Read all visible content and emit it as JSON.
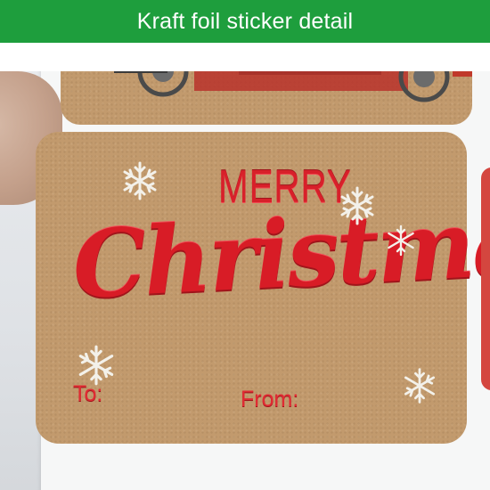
{
  "banner": {
    "title": "Kraft foil sticker detail",
    "color": "#1e9e3d"
  },
  "photo": {
    "sticker_material": "kraft paper",
    "kraft_color": "#c29a6d",
    "foil_color": "#d81c26",
    "main_sticker": {
      "greeting_top": "MERRY",
      "greeting_script": "Christmas",
      "to_label": "To:",
      "from_label": "From:"
    },
    "icons": [
      "snowflake-icon",
      "truck-illustration"
    ]
  }
}
